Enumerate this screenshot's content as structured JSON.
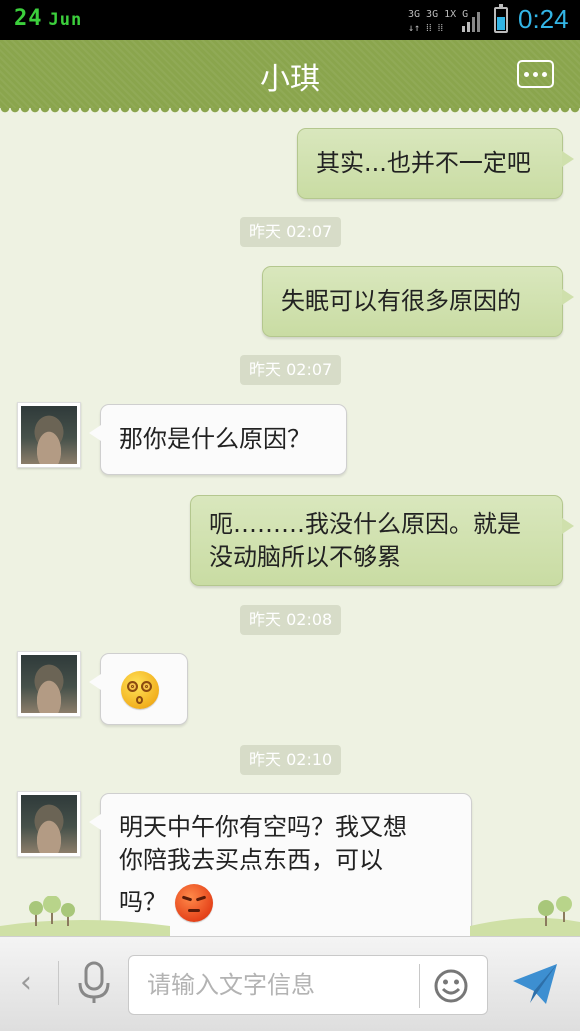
{
  "status_bar": {
    "date_day": "24",
    "date_month": "Jun",
    "network": "3G 3G 1X G",
    "time": "0:24",
    "battery_level": 0.6,
    "icons": [
      "signal-icon",
      "battery-icon"
    ]
  },
  "header": {
    "title": "小琪",
    "menu_icon": "more-options-icon"
  },
  "messages": [
    {
      "direction": "outgoing",
      "text": "其实...也并不一定吧"
    },
    {
      "timestamp": "昨天 02:07"
    },
    {
      "direction": "outgoing",
      "text": "失眠可以有很多原因的"
    },
    {
      "timestamp": "昨天 02:07"
    },
    {
      "direction": "incoming",
      "text": "那你是什么原因？"
    },
    {
      "direction": "outgoing",
      "text_line1": "呃………我没什么原因。就是",
      "text_line2": "没动脑所以不够累"
    },
    {
      "timestamp": "昨天 02:08"
    },
    {
      "direction": "incoming",
      "emoji": "dizzy-emoji"
    },
    {
      "timestamp": "昨天 02:10"
    },
    {
      "direction": "incoming",
      "text_line1": "明天中午你有空吗？我又想",
      "text_line2": "你陪我去买点东西，可以",
      "text_line3": "吗？",
      "emoji": "angry-emoji"
    }
  ],
  "input_bar": {
    "placeholder": "请输入文字信息",
    "icons": [
      "back-chevron-icon",
      "microphone-icon",
      "emoji-icon",
      "send-icon"
    ]
  },
  "colors": {
    "header": "#8aa54d",
    "chat_background": "#eef2e2",
    "outgoing_bubble": "#cfe0ac",
    "incoming_bubble": "#fbfbfb",
    "timestamp_pill": "#d7dcc8",
    "send_icon": "#3d8fd1"
  }
}
